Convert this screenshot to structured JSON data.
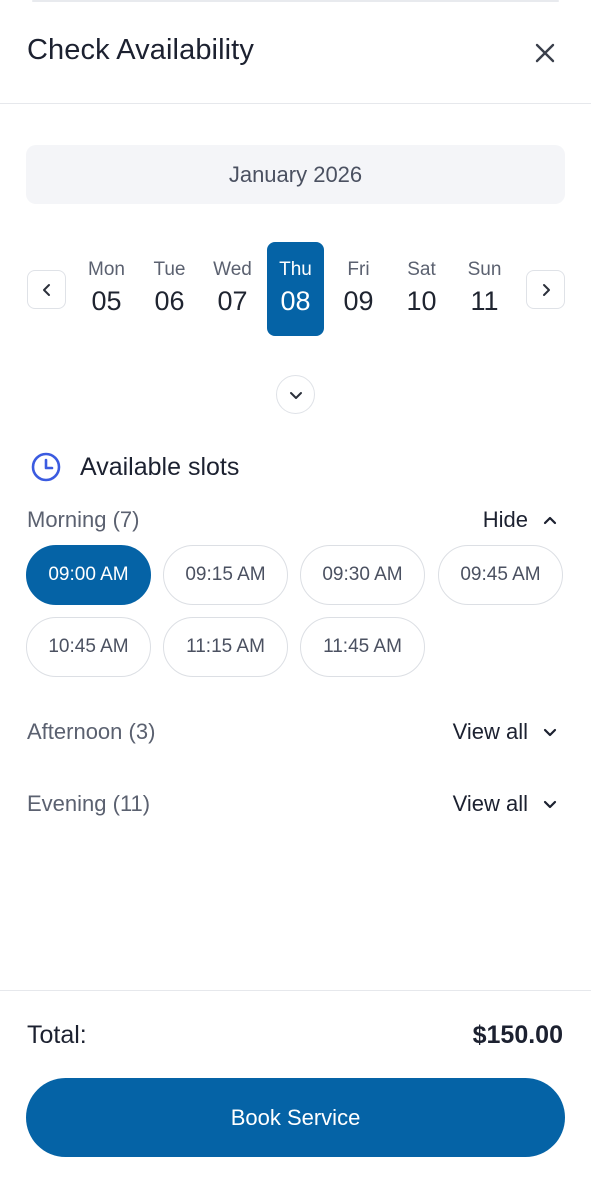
{
  "header": {
    "title": "Check Availability",
    "close_icon": "close-icon"
  },
  "calendar": {
    "month_label": "January 2026",
    "prev_icon": "chevron-left-icon",
    "next_icon": "chevron-right-icon",
    "expand_icon": "chevron-down-icon",
    "days": [
      {
        "name": "Mon",
        "num": "05",
        "selected": false
      },
      {
        "name": "Tue",
        "num": "06",
        "selected": false
      },
      {
        "name": "Wed",
        "num": "07",
        "selected": false
      },
      {
        "name": "Thu",
        "num": "08",
        "selected": true
      },
      {
        "name": "Fri",
        "num": "09",
        "selected": false
      },
      {
        "name": "Sat",
        "num": "10",
        "selected": false
      },
      {
        "name": "Sun",
        "num": "11",
        "selected": false
      }
    ]
  },
  "slots": {
    "title": "Available slots",
    "icon": "clock-icon",
    "morning": {
      "label": "Morning (7)",
      "action": "Hide",
      "action_icon": "chevron-up-icon",
      "times": [
        {
          "time": "09:00 AM",
          "selected": true
        },
        {
          "time": "09:15 AM",
          "selected": false
        },
        {
          "time": "09:30 AM",
          "selected": false
        },
        {
          "time": "09:45 AM",
          "selected": false
        },
        {
          "time": "10:45 AM",
          "selected": false
        },
        {
          "time": "11:15 AM",
          "selected": false
        },
        {
          "time": "11:45 AM",
          "selected": false
        }
      ]
    },
    "afternoon": {
      "label": "Afternoon (3)",
      "action": "View all",
      "action_icon": "chevron-down-icon"
    },
    "evening": {
      "label": "Evening (11)",
      "action": "View all",
      "action_icon": "chevron-down-icon"
    }
  },
  "footer": {
    "total_label": "Total:",
    "total_value": "$150.00",
    "book_label": "Book Service"
  },
  "colors": {
    "accent": "#0563a6",
    "clock_icon": "#3b5be0",
    "text_primary": "#1c2130",
    "text_secondary": "#5b6170",
    "border": "#dcdfe4"
  }
}
